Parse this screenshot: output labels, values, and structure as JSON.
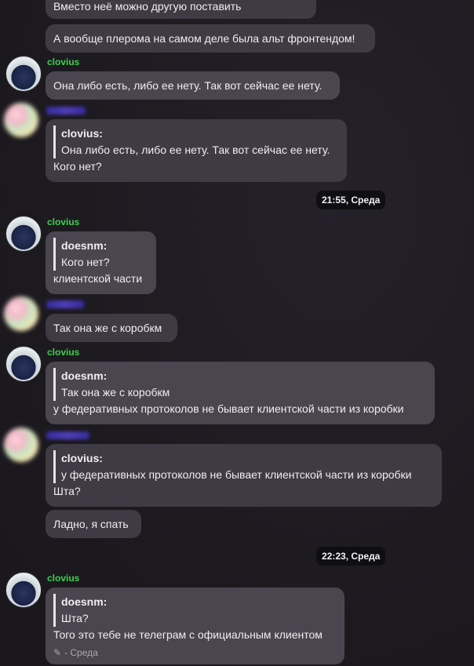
{
  "messages": {
    "m1": "Вместо неё можно другую поставить",
    "m2": "А вообще плерома на самом деле была альт фронтендом!",
    "m3_author": "clovius",
    "m3": "Она либо есть, либо ее нету. Так вот сейчас ее нету.",
    "m4_quote_author": "clovius:",
    "m4_quote": "Она либо есть, либо ее нету. Так вот сейчас ее нету.",
    "m4": "Кого нет?",
    "ts1": "21:55, Среда",
    "m5_author": "clovius",
    "m5_quote_author": "doesnm:",
    "m5_quote": "Кого нет?",
    "m5": "клиентской части",
    "m6": "Так она же с коробкм",
    "m7_author": "clovius",
    "m7_quote_author": "doesnm:",
    "m7_quote": "Так она же с коробкм",
    "m7": "у федеративных протоколов не бывает клиентской части из коробки",
    "m8_quote_author": "clovius:",
    "m8_quote": "у федеративных протоколов не бывает клиентской части из коробки",
    "m8": "Шта?",
    "m9": "Ладно, я спать",
    "ts2": "22:23, Среда",
    "m10_author": "clovius",
    "m10_quote_author": "doesnm:",
    "m10_quote": "Шта?",
    "m10": "Того это тебе не телеграм с официальным клиентом",
    "m10_edited": "- Среда"
  },
  "colors": {
    "author_name": "#3fcf4f",
    "bubble": "#4a4650",
    "timestamp_bg": "#0f0e11"
  }
}
